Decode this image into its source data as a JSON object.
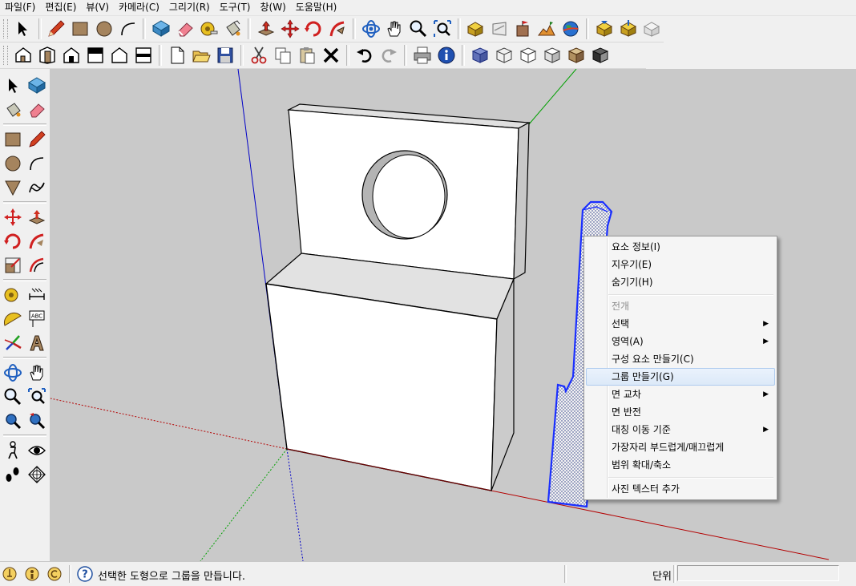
{
  "menubar": {
    "items": [
      "파일(F)",
      "편집(E)",
      "뷰(V)",
      "카메라(C)",
      "그리기(R)",
      "도구(T)",
      "창(W)",
      "도움말(H)"
    ]
  },
  "toolbar_top": {
    "icons": [
      "select-arrow-icon",
      "pencil-line-icon",
      "rectangle-icon",
      "circle-icon",
      "arc-icon",
      "make-component-icon",
      "eraser-icon",
      "tape-measure-icon",
      "paint-bucket-icon",
      "push-pull-icon",
      "move-icon",
      "rotate-icon",
      "follow-me-icon",
      "orbit-icon",
      "pan-hand-icon",
      "zoom-icon",
      "zoom-extents-icon",
      "get-models-icon",
      "share-model-icon",
      "add-location-icon",
      "toggle-terrain-icon",
      "google-earth-icon",
      "get-models-3d-icon",
      "share-component-icon",
      "share-model-2-icon"
    ]
  },
  "toolbar_bottom": {
    "icons": [
      "iso-view-icon",
      "top-view-icon",
      "front-view-icon",
      "right-view-icon",
      "back-view-icon",
      "left-view-icon",
      "new-file-icon",
      "open-file-icon",
      "save-icon",
      "cut-icon",
      "copy-icon",
      "paste-icon",
      "delete-icon",
      "undo-icon",
      "redo-icon",
      "print-icon",
      "model-info-icon",
      "xray-icon",
      "wireframe-icon",
      "hidden-line-icon",
      "shaded-icon",
      "shaded-textures-icon",
      "monochrome-icon"
    ]
  },
  "left_toolbar": {
    "icons": [
      "select-arrow-icon",
      "make-component-icon",
      "paint-bucket-icon",
      "eraser-icon",
      "rectangle-icon",
      "pencil-line-icon",
      "circle-icon",
      "arc-icon",
      "polygon-icon",
      "freehand-icon",
      "move-icon",
      "push-pull-icon",
      "rotate-icon",
      "follow-me-icon",
      "scale-icon",
      "offset-icon",
      "tape-measure-icon",
      "dimension-icon",
      "protractor-icon",
      "text-icon",
      "axes-icon",
      "3d-text-icon",
      "orbit-icon",
      "pan-hand-icon",
      "zoom-icon",
      "zoom-window-icon",
      "zoom-extents-icon",
      "previous-view-icon",
      "position-camera-icon",
      "look-around-icon",
      "walk-icon",
      "section-plane-icon"
    ],
    "text_tool_label": "ABC"
  },
  "context_menu": {
    "items": [
      {
        "label": "요소 정보(I)",
        "disabled": false,
        "submenu": false
      },
      {
        "label": "지우기(E)",
        "disabled": false,
        "submenu": false
      },
      {
        "label": "숨기기(H)",
        "disabled": false,
        "submenu": false
      },
      {
        "label": "전개",
        "disabled": true,
        "submenu": false
      },
      {
        "label": "선택",
        "disabled": false,
        "submenu": true
      },
      {
        "label": "영역(A)",
        "disabled": false,
        "submenu": true
      },
      {
        "label": "구성 요소 만들기(C)",
        "disabled": false,
        "submenu": false
      },
      {
        "label": "그룹 만들기(G)",
        "disabled": false,
        "submenu": false,
        "highlighted": true
      },
      {
        "label": "면 교차",
        "disabled": false,
        "submenu": true
      },
      {
        "label": "면 반전",
        "disabled": false,
        "submenu": false
      },
      {
        "label": "대칭 이동 기준",
        "disabled": false,
        "submenu": true
      },
      {
        "label": "가장자리 부드럽게/매끄럽게",
        "disabled": false,
        "submenu": false
      },
      {
        "label": "범위 확대/축소",
        "disabled": false,
        "submenu": false
      },
      {
        "label": "사진 텍스터 추가",
        "disabled": false,
        "submenu": false
      }
    ],
    "submenu_arrow": "▶"
  },
  "statusbar": {
    "message": "선택한 도형으로 그룹을 만듭니다.",
    "measurements_label": "단위",
    "measurements_value": "",
    "icons": [
      "georeference-icon",
      "credits-icon",
      "copyright-icon",
      "help-icon"
    ]
  },
  "colors": {
    "viewport_bg": "#c9c9c9",
    "selection_blue": "#1a2fff",
    "axis_red": "#b40000",
    "axis_green": "#00a000",
    "axis_blue": "#0000c8",
    "menu_highlight": "#dce9f8"
  }
}
